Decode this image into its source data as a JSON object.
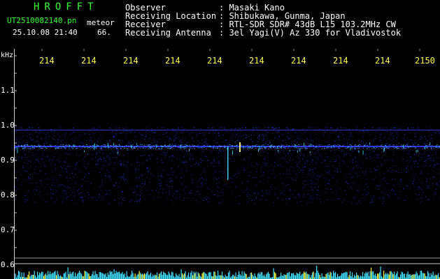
{
  "app": {
    "title": "HROFFT",
    "filename": "UT2510082140.pn",
    "meteor_label": "meteor",
    "datetime": "25.10.08 21:40",
    "count": "66."
  },
  "info": {
    "rows": [
      {
        "label": "Observer",
        "value": ": Masaki Kano"
      },
      {
        "label": "Receiving Location",
        "value": ": Shibukawa, Gunma, Japan"
      },
      {
        "label": "Receiver",
        "value": ": RTL-SDR SDR# 43dB L15 103.2MHz CW"
      },
      {
        "label": "Receiving Antenna",
        "value": ": 3el Yagi(V) Az 330 for Vladivostok"
      }
    ]
  },
  "axis": {
    "y_unit": "kHz",
    "y_ticks": [
      "1.1",
      "1.0",
      "0.9",
      "0.8",
      "0.7",
      "0.6"
    ],
    "x_ticks": [
      "214",
      "214",
      "214",
      "214",
      "214",
      "214",
      "214",
      "214",
      "214",
      "2150"
    ]
  },
  "colors": {
    "background": "#000000",
    "text_header": "#ffffff",
    "title_green": "#30ff30",
    "tick_yellow": "#ffff40",
    "signal_blue": "#2a3cff",
    "signal_cyan": "#40e0ff",
    "meteor_yellow": "#ffff40"
  }
}
